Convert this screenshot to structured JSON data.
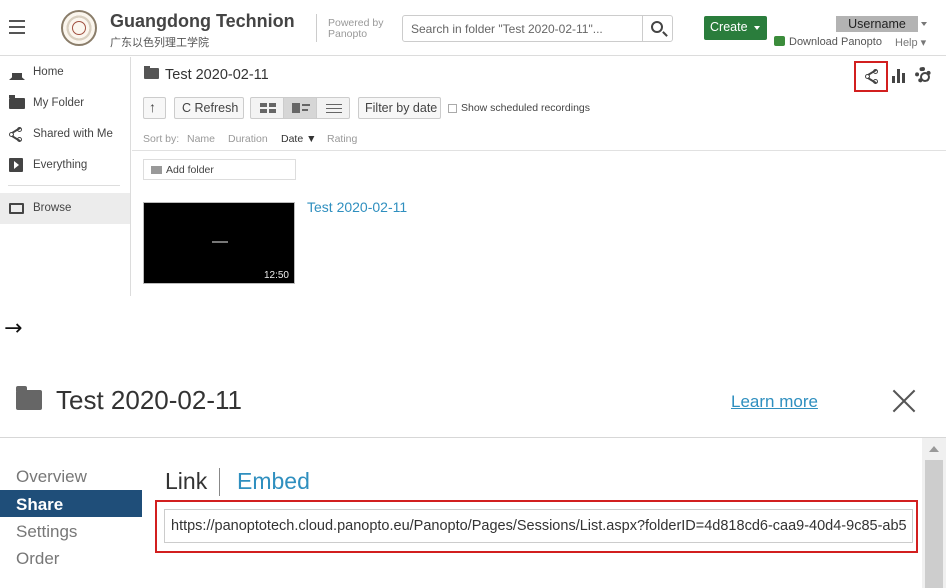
{
  "header": {
    "brand_title": "Guangdong Technion",
    "brand_subtitle": "广东以色列理工学院",
    "powered_by": "Powered by Panopto",
    "search_placeholder": "Search in folder \"Test 2020-02-11\"...",
    "create_label": "Create",
    "username": "Username",
    "download_label": "Download Panopto",
    "help_label": "Help ▾"
  },
  "sidebar": {
    "items": [
      {
        "label": "Home",
        "icon": "home-icon"
      },
      {
        "label": "My Folder",
        "icon": "my-folder-icon"
      },
      {
        "label": "Shared with Me",
        "icon": "share-icon"
      },
      {
        "label": "Everything",
        "icon": "play-icon"
      },
      {
        "label": "Browse",
        "icon": "folder-outline-icon",
        "active": true
      }
    ]
  },
  "folder": {
    "title": "Test 2020-02-11"
  },
  "toolbar": {
    "refresh_label": "C Refresh",
    "filter_label": "Filter by date",
    "scheduled_label": "Show scheduled recordings"
  },
  "sort": {
    "label": "Sort by:",
    "options": [
      "Name",
      "Duration",
      "Date ▼",
      "Rating"
    ]
  },
  "add_folder_label": "Add folder",
  "session": {
    "title": "Test 2020-02-11",
    "duration": "12:50"
  },
  "arrow": "→",
  "dialog": {
    "title": "Test 2020-02-11",
    "learn_more": "Learn more",
    "nav": [
      {
        "label": "Overview"
      },
      {
        "label": "Share",
        "selected": true
      },
      {
        "label": "Settings"
      },
      {
        "label": "Order"
      }
    ],
    "tab_link": "Link",
    "tab_embed": "Embed",
    "url": "https://panoptotech.cloud.panopto.eu/Panopto/Pages/Sessions/List.aspx?folderID=4d818cd6-caa9-40d4-9c85-ab5"
  },
  "colors": {
    "accent_green": "#2a7d3c",
    "link_blue": "#2f8fbf",
    "highlight_red": "#d21f1f",
    "nav_selected": "#1f4e79"
  }
}
